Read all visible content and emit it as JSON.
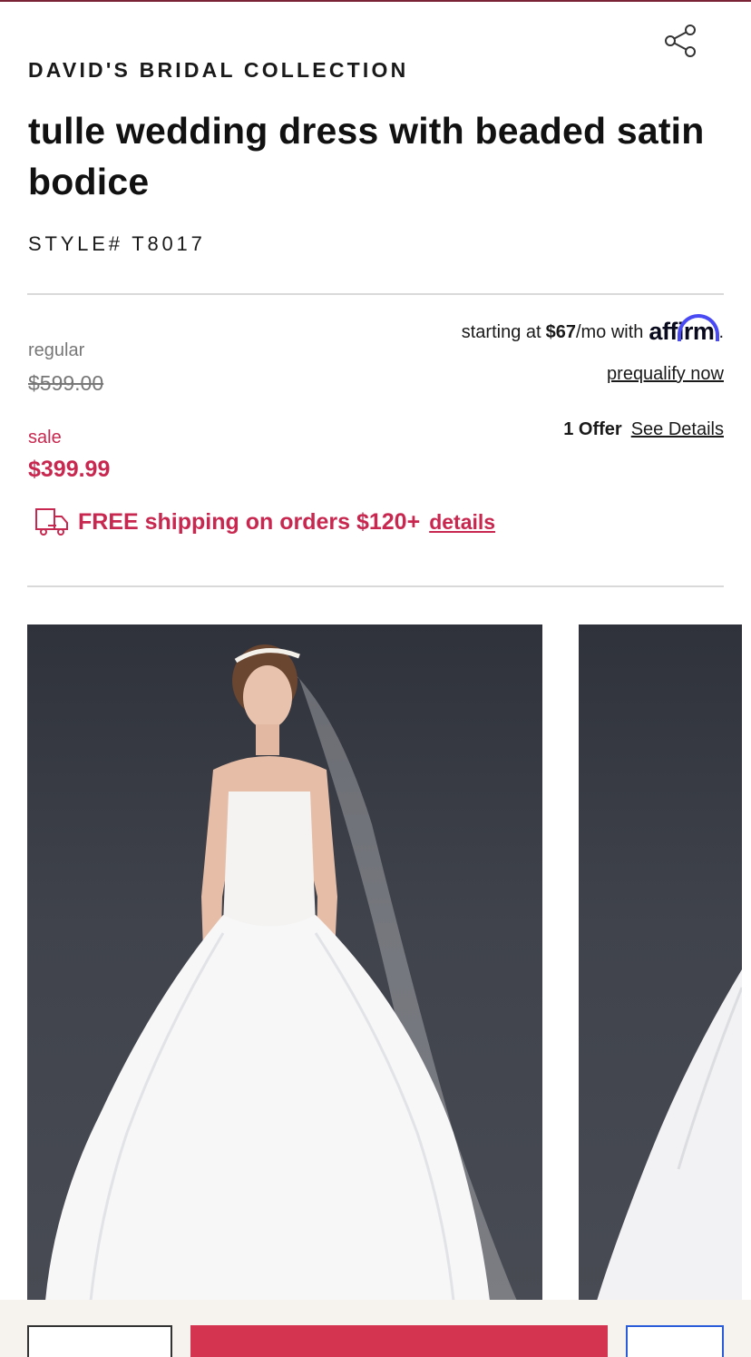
{
  "product": {
    "brand": "DAVID'S BRIDAL COLLECTION",
    "title": "tulle wedding dress with beaded satin bodice",
    "style": "STYLE# T8017"
  },
  "pricing": {
    "regular_label": "regular",
    "regular_price": "$599.00",
    "sale_label": "sale",
    "sale_price": "$399.99",
    "sale_color": "#c8284f"
  },
  "financing": {
    "prefix": "starting at",
    "amount": "$67",
    "suffix": "/mo with",
    "provider": "affirm",
    "end_mark": ".",
    "prequalify": "prequalify now"
  },
  "offers": {
    "count": "1 Offer",
    "see_details": "See Details"
  },
  "shipping": {
    "icon": "delivery-truck-icon",
    "text": "FREE shipping on orders $120+",
    "details": "details"
  },
  "gallery": {
    "images": [
      "bride-front-view",
      "bride-side-view"
    ]
  },
  "icons": {
    "share": "share-icon"
  }
}
